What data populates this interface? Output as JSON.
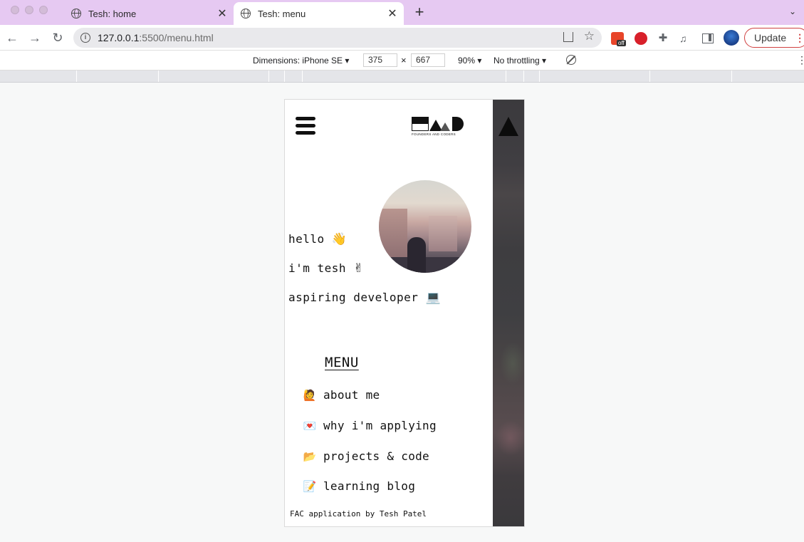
{
  "browser": {
    "tabs": [
      {
        "title": "Tesh: home",
        "active": false
      },
      {
        "title": "Tesh: menu",
        "active": true
      }
    ],
    "url_host": "127.0.0.1",
    "url_rest": ":5500/menu.html",
    "update_label": "Update",
    "extension_badge": "off"
  },
  "devtools": {
    "dimensions_label": "Dimensions: iPhone SE ▾",
    "width": "375",
    "height": "667",
    "zoom": "90% ▾",
    "throttling": "No throttling ▾"
  },
  "page": {
    "logo_text": "FOUNDERS AND CODERS",
    "greeting": [
      {
        "text": "hello",
        "emoji": "👋"
      },
      {
        "text": "i'm tesh",
        "emoji": "✌"
      },
      {
        "text": "aspiring developer",
        "emoji": "💻"
      }
    ],
    "menu_title": "MENU",
    "menu_items": [
      {
        "label": "about me",
        "icon": "🙋"
      },
      {
        "label": "why i'm applying",
        "icon": "💌"
      },
      {
        "label": "projects & code",
        "icon": "📂"
      },
      {
        "label": "learning blog",
        "icon": "📝"
      }
    ],
    "footer": "FAC application by Tesh Patel"
  }
}
